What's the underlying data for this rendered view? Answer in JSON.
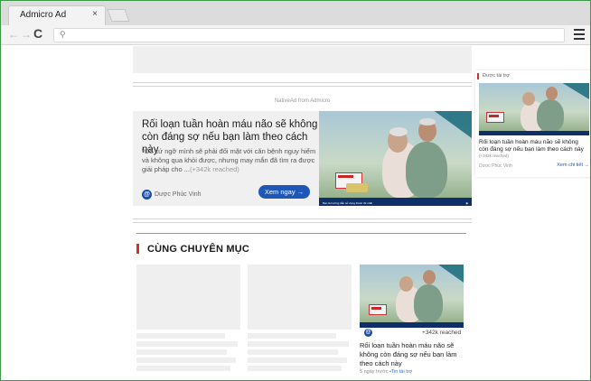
{
  "browser": {
    "tab_title": "Admicro Ad",
    "tab_close": "×",
    "back_icon": "arrow-left-icon",
    "forward_icon": "arrow-right-icon",
    "reload_icon": "reload-icon",
    "search_icon": "search-icon",
    "menu_icon": "hamburger-menu-icon"
  },
  "native_ad": {
    "label": "NativeAd from Admicro",
    "title": "Rối loạn tuần hoàn máu não sẽ không còn đáng sợ nếu bạn làm theo cách này",
    "description": "\"Cô cứ ngỡ mình sẽ phải đối mặt với căn bệnh nguy hiểm và không qua khỏi được, nhưng may mắn đã tìm ra được giải pháp cho ...",
    "reached": "(+342k reached)",
    "brand": "Dược Phúc Vinh",
    "cta": "Xem ngay →",
    "image_caption": "Bạn là hướng dẫn sử dụng thuốc tốt nhất"
  },
  "section": {
    "title": "CÙNG CHUYÊN MỤC"
  },
  "related_card": {
    "reached": "+342k reached",
    "title": "Rối loạn tuần hoàn máu não sẽ không còn đáng sợ nếu bạn làm theo cách này",
    "time": "5 ngày trước",
    "tag": "•Tin tài trợ"
  },
  "sidebar_ad": {
    "heading": "Được tài trợ",
    "title": "Rối loạn tuần hoàn máu não sẽ không còn đáng sợ nếu bạn làm theo cách này",
    "reached": "(+342k reached)",
    "brand": "Dược Phúc Vinh",
    "cta": "Xem chi tiết →"
  },
  "colors": {
    "accent_red": "#d32f2f",
    "cta_blue": "#1f57b8",
    "frame_green": "#3a9a4a"
  }
}
